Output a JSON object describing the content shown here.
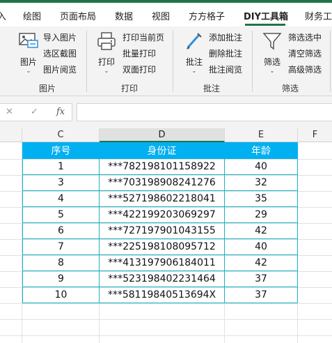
{
  "ribbon_tabs": [
    {
      "label": "入"
    },
    {
      "label": "绘图"
    },
    {
      "label": "页面布局"
    },
    {
      "label": "数据"
    },
    {
      "label": "视图"
    },
    {
      "label": "方方格子"
    },
    {
      "label": "DIY工具箱",
      "active": true
    },
    {
      "label": "财务工"
    }
  ],
  "ribbon": {
    "groups": {
      "picture": {
        "title": "图片",
        "big_label": "图片",
        "items": [
          "导入图片",
          "选区截图",
          "图片阅览"
        ]
      },
      "print": {
        "title": "打印",
        "big_label": "打印",
        "items": [
          "打印当前页",
          "批量打印",
          "双面打印"
        ]
      },
      "comment": {
        "title": "批注",
        "big_label": "批注",
        "items": [
          "添加批注",
          "删除批注",
          "批注阅览"
        ]
      },
      "filter": {
        "title": "筛选",
        "big_label": "筛选",
        "items": [
          "筛选选中",
          "清空筛选",
          "高级筛选"
        ]
      }
    }
  },
  "formula_bar": {
    "cancel_icon": "✕",
    "confirm_icon": "✓",
    "fx_label": "fx",
    "value": ""
  },
  "sheet": {
    "columns": [
      "C",
      "D",
      "E",
      "F"
    ],
    "selected_column": "D",
    "table": {
      "headers": [
        "序号",
        "身份证",
        "年龄"
      ],
      "rows": [
        [
          "1",
          "***782198101158922",
          "40"
        ],
        [
          "3",
          "***703198908241276",
          "32"
        ],
        [
          "4",
          "***527198602218041",
          "35"
        ],
        [
          "5",
          "***422199203069297",
          "29"
        ],
        [
          "6",
          "***727197901043155",
          "42"
        ],
        [
          "7",
          "***225198108095712",
          "40"
        ],
        [
          "8",
          "***413197906184011",
          "42"
        ],
        [
          "9",
          "***523198402231464",
          "37"
        ],
        [
          "10",
          "***58119840513694X",
          "37"
        ]
      ]
    }
  },
  "colors": {
    "accent": "#217346",
    "header_fill": "#00b0f0",
    "table_border": "#17b3c4"
  }
}
